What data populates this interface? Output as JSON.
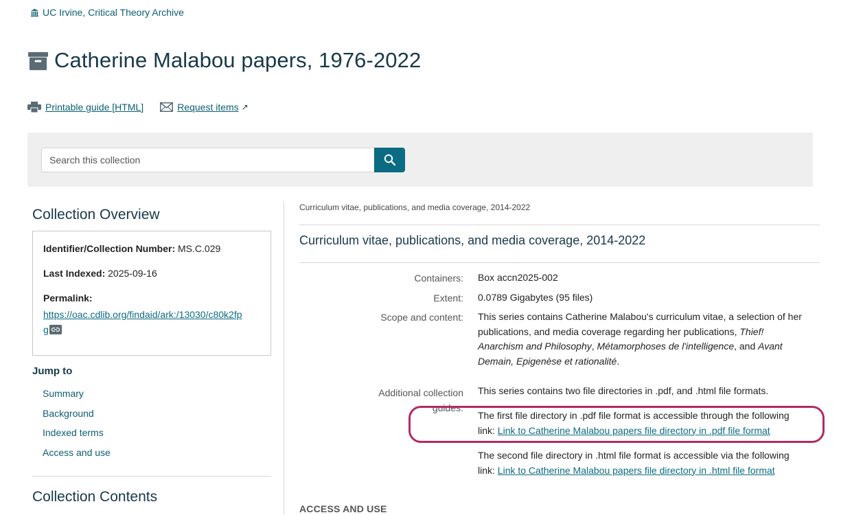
{
  "institution": "UC Irvine, Critical Theory Archive",
  "page_title": "Catherine Malabou papers, 1976-2022",
  "actions": {
    "printable": "Printable guide [HTML]",
    "request": "Request items",
    "request_external_mark": "↗"
  },
  "search": {
    "placeholder": "Search this collection"
  },
  "overview": {
    "heading": "Collection Overview",
    "identifier_label": "Identifier/Collection Number:",
    "identifier_value": "MS.C.029",
    "last_indexed_label": "Last Indexed:",
    "last_indexed_value": "2025-09-16",
    "permalink_label": "Permalink:",
    "permalink_line1": "https://oac.cdlib.org/findaid/ark:/13030/c80k2fp",
    "permalink_line2": "g"
  },
  "jump_to": {
    "heading": "Jump to",
    "items": [
      "Summary",
      "Background",
      "Indexed terms",
      "Access and use"
    ]
  },
  "contents_heading": "Collection Contents",
  "series": {
    "breadcrumb": "Curriculum vitae, publications, and media coverage, 2014-2022",
    "title": "Curriculum vitae, publications, and media coverage, 2014-2022",
    "containers_label": "Containers:",
    "containers_value": "Box accn2025-002",
    "extent_label": "Extent:",
    "extent_value": "0.0789 Gigabytes (95 files)",
    "scope_label": "Scope and content:",
    "scope_line1": "This series contains Catherine Malabou's curriculum vitae, a selection of her",
    "scope_line2a": "publications, and media coverage regarding her publications, ",
    "scope_line2b": "Thief!",
    "scope_line3a": "Anarchism and Philosophy",
    "scope_line3b": ", ",
    "scope_line3c": "Métamorphoses de l'intelligence",
    "scope_line3d": ", and ",
    "scope_line3e": "Avant",
    "scope_line4a": "Demain, Epigenèse et rationalité",
    "scope_line4b": ".",
    "guides_label_1": "Additional collection",
    "guides_label_2": "guides:",
    "guides_intro": "This series contains two file directories in .pdf, and .html file formats.",
    "pdf_text_1": "The first file directory in .pdf file format is accessible through the following",
    "pdf_text_2": "link: ",
    "pdf_link": "Link to Catherine Malabou papers file directory in .pdf file format",
    "html_text_1": "The second file directory in .html file format is accessible via the following",
    "html_text_2": "link: ",
    "html_link": "Link to Catherine Malabou papers file directory in .html file format"
  },
  "access_heading": "ACCESS AND USE",
  "colors": {
    "accent": "#0b6b82",
    "heading": "#17394a",
    "highlight": "#b22a64"
  }
}
